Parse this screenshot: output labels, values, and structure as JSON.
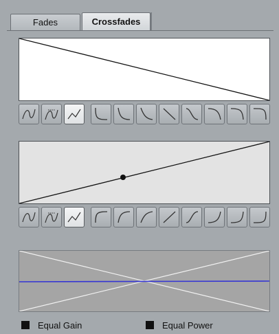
{
  "tabs": [
    {
      "label": "Fades",
      "active": false
    },
    {
      "label": "Crossfades",
      "active": true
    }
  ],
  "fade_out_curve": {
    "shape": "linear",
    "direction": "down"
  },
  "fade_in_curve": {
    "shape": "linear",
    "direction": "up"
  },
  "curve_type_buttons": [
    "spline-curve-icon",
    "damped-spline-curve-icon",
    "curve-kind-icon"
  ],
  "fade_out_presets": [
    "fade-preset-icon",
    "fade-preset-icon",
    "fade-preset-icon",
    "fade-preset-icon",
    "fade-preset-icon",
    "fade-preset-icon",
    "fade-preset-icon",
    "fade-preset-icon"
  ],
  "fade_in_presets": [
    "fade-preset-icon",
    "fade-preset-icon",
    "fade-preset-icon",
    "fade-preset-icon",
    "fade-preset-icon",
    "fade-preset-icon",
    "fade-preset-icon",
    "fade-preset-icon"
  ],
  "legend": {
    "equal_gain": {
      "label": "Equal Gain",
      "checked": true
    },
    "equal_power": {
      "label": "Equal Power",
      "checked": true
    }
  },
  "colors": {
    "panel_bg": "#a4a9ad",
    "graph_bg_out": "#ffffff",
    "graph_bg_in": "#e3e3e3",
    "preview_bg": "#a5a5a5",
    "sum_line": "#3434d4"
  }
}
